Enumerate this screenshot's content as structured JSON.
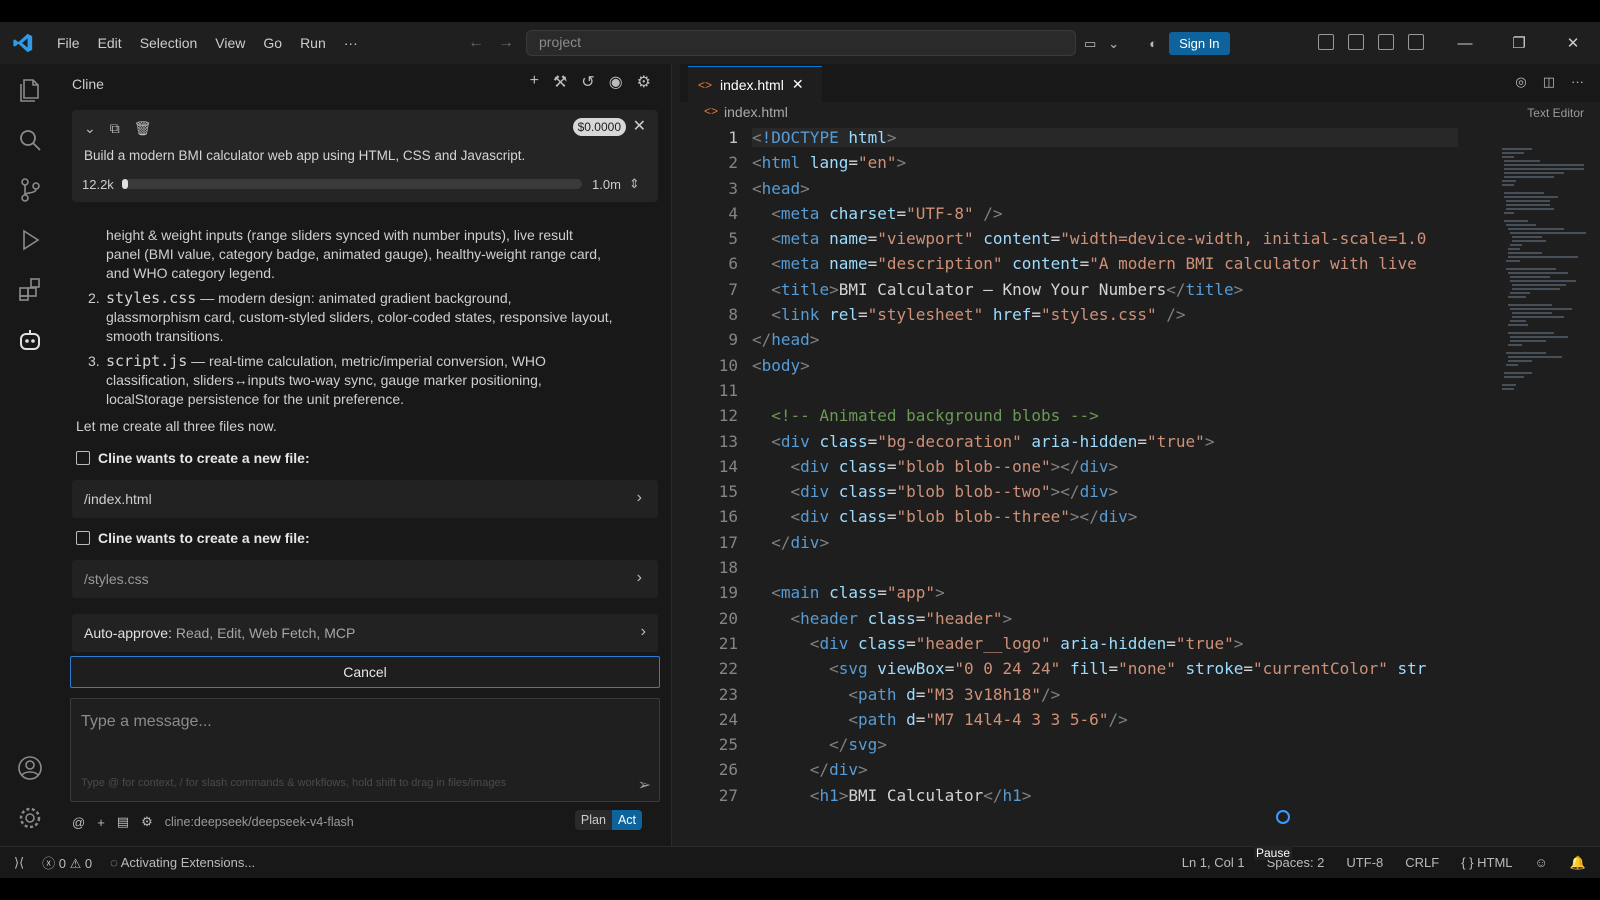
{
  "titlebar": {
    "menu": [
      "File",
      "Edit",
      "Selection",
      "View",
      "Go",
      "Run",
      "···"
    ],
    "search": "project",
    "signin": "Sign In"
  },
  "panel": {
    "title": "Cline",
    "task": {
      "cost": "$0.0000",
      "text": "Build a modern BMI calculator web app using HTML, CSS and Javascript.",
      "tokens_in": "12.2k",
      "tokens_max": "1.0m",
      "context_fraction": 0.012
    },
    "message": {
      "item1_cont": [
        "height & weight inputs (range sliders synced with number inputs), live result",
        "panel (BMI value, category badge, animated gauge), healthy-weight range card,",
        "and WHO category legend."
      ],
      "item2_num": "2.",
      "item2_file": "styles.css",
      "item2_lines": [
        " — modern design: animated gradient background,",
        "glassmorphism card, custom-styled sliders, color-coded states, responsive layout,",
        "smooth transitions."
      ],
      "item3_num": "3.",
      "item3_file": "script.js",
      "item3_lines": [
        " — real-time calculation, metric/imperial conversion, WHO",
        "classification, sliders↔inputs two-way sync, gauge marker positioning,",
        "localStorage persistence for the unit preference."
      ],
      "closing": "Let me create all three files now."
    },
    "tool1": {
      "heading": "Cline wants to create a new file:",
      "file": "/index.html"
    },
    "tool2": {
      "heading": "Cline wants to create a new file:",
      "file": "/styles.css"
    },
    "auto_approve": {
      "label": "Auto-approve:",
      "value": " Read, Edit, Web Fetch, MCP"
    },
    "cancel": "Cancel",
    "composer": {
      "placeholder": "Type a message...",
      "hint": "Type @ for context, / for slash commands & workflows, hold shift to drag in files/images"
    },
    "model": "cline:deepseek/deepseek-v4-flash",
    "mode": {
      "plan": "Plan",
      "act": "Act"
    }
  },
  "editor": {
    "tab": "index.html",
    "breadcrumb": "index.html",
    "mode_label": "Text Editor",
    "lines": [
      "1",
      "2",
      "3",
      "4",
      "5",
      "6",
      "7",
      "8",
      "9",
      "10",
      "11",
      "12",
      "13",
      "14",
      "15",
      "16",
      "17",
      "18",
      "19",
      "20",
      "21",
      "22",
      "23",
      "24",
      "25",
      "26",
      "27"
    ]
  },
  "statusbar": {
    "errors": "0",
    "warnings": "0",
    "activity": "Activating Extensions...",
    "pause": "Pause",
    "position": "Ln 1, Col 1",
    "spaces": "Spaces: 2",
    "encoding": "UTF-8",
    "eol": "CRLF",
    "language": "HTML"
  }
}
